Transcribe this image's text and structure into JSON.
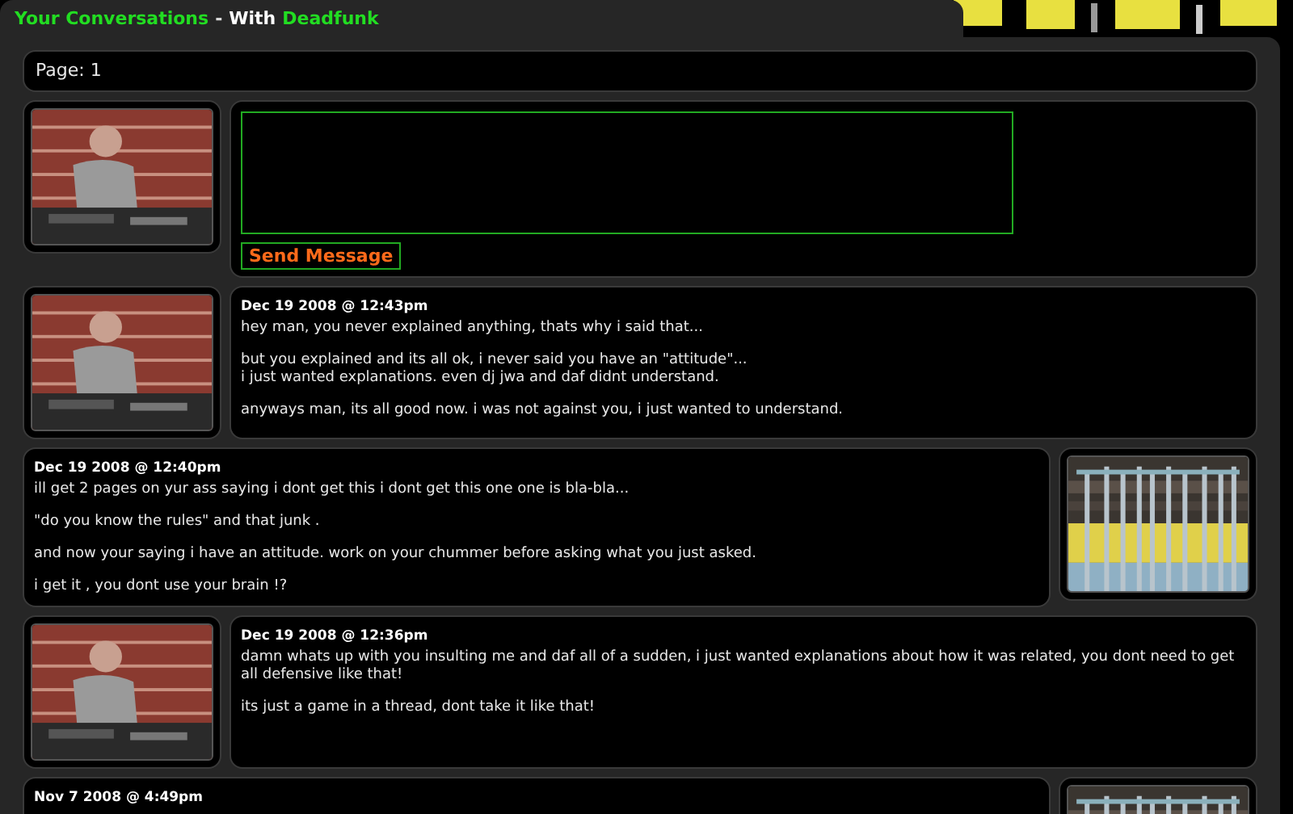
{
  "header": {
    "title": "Your Conversations",
    "separator": "-",
    "with_label": "With",
    "username": "Deadfunk"
  },
  "pager": {
    "label": "Page: 1"
  },
  "compose": {
    "button": "Send Message"
  },
  "messages": [
    {
      "kind": "theirs",
      "date": "Dec 19 2008 @ 12:43pm",
      "paragraphs": [
        "hey man, you never explained anything, thats why i said that...",
        "but you explained and its all ok, i never said you have an \"attitude\"...\ni just wanted explanations. even dj jwa and daf didnt understand.",
        "anyways man, its all good now. i was not against you, i just wanted to understand."
      ]
    },
    {
      "kind": "mine",
      "date": "Dec 19 2008 @ 12:40pm",
      "paragraphs": [
        "ill get 2 pages on yur ass saying i dont get this i dont get this one one is bla-bla...",
        "\"do you know the rules\" and that junk .",
        "and now your saying i have an attitude. work on your chummer before asking what you just asked.",
        "i get it , you dont use your brain !?"
      ]
    },
    {
      "kind": "theirs",
      "date": "Dec 19 2008 @ 12:36pm",
      "paragraphs": [
        "damn whats up with you insulting me and daf all of a sudden, i just wanted explanations about how it was related, you dont need to get all defensive like that!",
        "its just a game in a thread, dont take it like that!"
      ]
    },
    {
      "kind": "mine",
      "date": "Nov 7 2008 @ 4:49pm"
    }
  ]
}
